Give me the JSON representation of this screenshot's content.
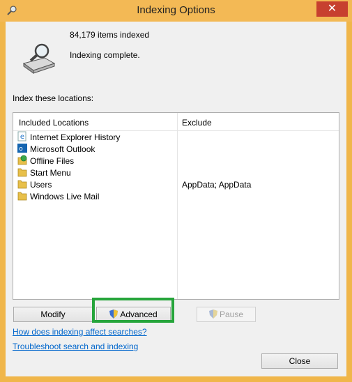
{
  "window": {
    "title": "Indexing Options",
    "close_glyph": "✕"
  },
  "status": {
    "count_text": "84,179 items indexed",
    "message": "Indexing complete."
  },
  "locations": {
    "label": "Index these locations:",
    "headers": {
      "included": "Included Locations",
      "exclude": "Exclude"
    },
    "rows": [
      {
        "name": "Internet Explorer History",
        "exclude": "",
        "icon": "ie-icon"
      },
      {
        "name": "Microsoft Outlook",
        "exclude": "",
        "icon": "outlook-icon"
      },
      {
        "name": "Offline Files",
        "exclude": "",
        "icon": "offline-files-icon"
      },
      {
        "name": "Start Menu",
        "exclude": "",
        "icon": "folder-icon"
      },
      {
        "name": "Users",
        "exclude": "AppData; AppData",
        "icon": "folder-icon"
      },
      {
        "name": "Windows Live Mail",
        "exclude": "",
        "icon": "folder-icon"
      }
    ]
  },
  "buttons": {
    "modify": "Modify",
    "advanced": "Advanced",
    "pause": "Pause",
    "close": "Close"
  },
  "links": {
    "how": "How does indexing affect searches?",
    "troubleshoot": "Troubleshoot search and indexing"
  },
  "colors": {
    "accent_frame": "#f0b64a",
    "highlight": "#26a53b",
    "link": "#0066cc"
  }
}
